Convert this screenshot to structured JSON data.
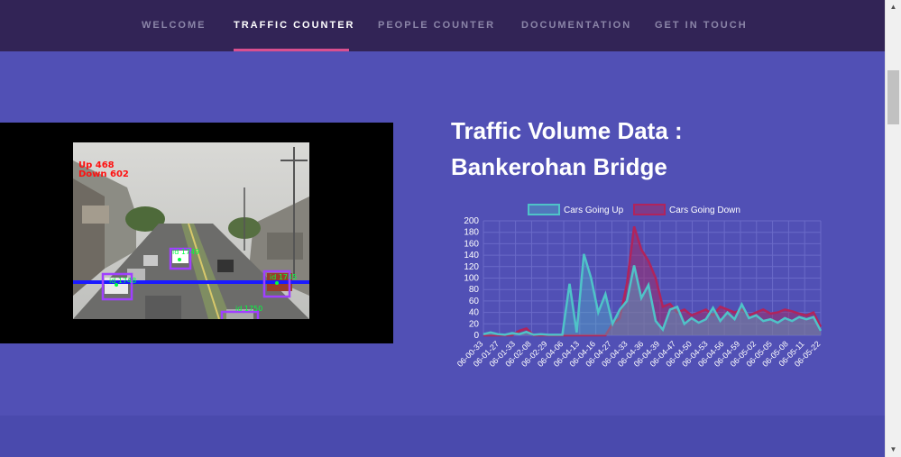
{
  "nav": {
    "items": [
      {
        "label": "WELCOME"
      },
      {
        "label": "TRAFFIC COUNTER"
      },
      {
        "label": "PEOPLE COUNTER"
      },
      {
        "label": "DOCUMENTATION"
      },
      {
        "label": "GET IN TOUCH"
      }
    ],
    "active_index": 1
  },
  "headline": {
    "line1": "Traffic Volume Data :",
    "line2": "Bankerohan Bridge"
  },
  "video": {
    "count_up": "Up 468",
    "count_down": "Down 602",
    "track_labels": [
      "id 1748",
      "id 1745",
      "id 1750",
      "id 1749"
    ]
  },
  "colors": {
    "accent": "#d94f8f",
    "nav_bg": "#322456",
    "main_bg": "#5150b5",
    "series_up": "#4fc3c8",
    "series_down": "#b0245c"
  },
  "chart_data": {
    "type": "area",
    "legend": [
      "Cars Going Up",
      "Cars Going Down"
    ],
    "legend_position": "top",
    "ylim": [
      0,
      200
    ],
    "yticks": [
      0,
      20,
      40,
      60,
      80,
      100,
      120,
      140,
      160,
      180,
      200
    ],
    "grid": true,
    "xtick_labels": [
      "06-00-33",
      "06-01-27",
      "06-01-33",
      "06-02-08",
      "06-02-29",
      "06-04-06",
      "06-04-13",
      "06-04-16",
      "06-04-27",
      "06-04-33",
      "06-04-36",
      "06-04-39",
      "06-04-47",
      "06-04-50",
      "06-04-53",
      "06-04-56",
      "06-04-59",
      "06-05-02",
      "06-05-05",
      "06-05-08",
      "06-05-11",
      "06-05-22"
    ],
    "series": [
      {
        "name": "Cars Going Up",
        "values": [
          2,
          5,
          2,
          1,
          4,
          2,
          6,
          1,
          2,
          1,
          1,
          1,
          90,
          5,
          142,
          100,
          40,
          72,
          20,
          45,
          60,
          122,
          65,
          88,
          25,
          10,
          45,
          50,
          20,
          30,
          22,
          28,
          48,
          25,
          40,
          28,
          54,
          30,
          35,
          25,
          28,
          22,
          30,
          25,
          32,
          28,
          32,
          8
        ]
      },
      {
        "name": "Cars Going Down",
        "values": [
          0,
          0,
          0,
          0,
          0,
          8,
          12,
          0,
          0,
          0,
          0,
          0,
          0,
          0,
          0,
          0,
          0,
          0,
          20,
          30,
          90,
          190,
          150,
          130,
          100,
          50,
          55,
          40,
          45,
          35,
          40,
          45,
          35,
          50,
          45,
          40,
          45,
          35,
          40,
          45,
          38,
          40,
          45,
          42,
          38,
          35,
          40,
          15
        ]
      }
    ]
  }
}
